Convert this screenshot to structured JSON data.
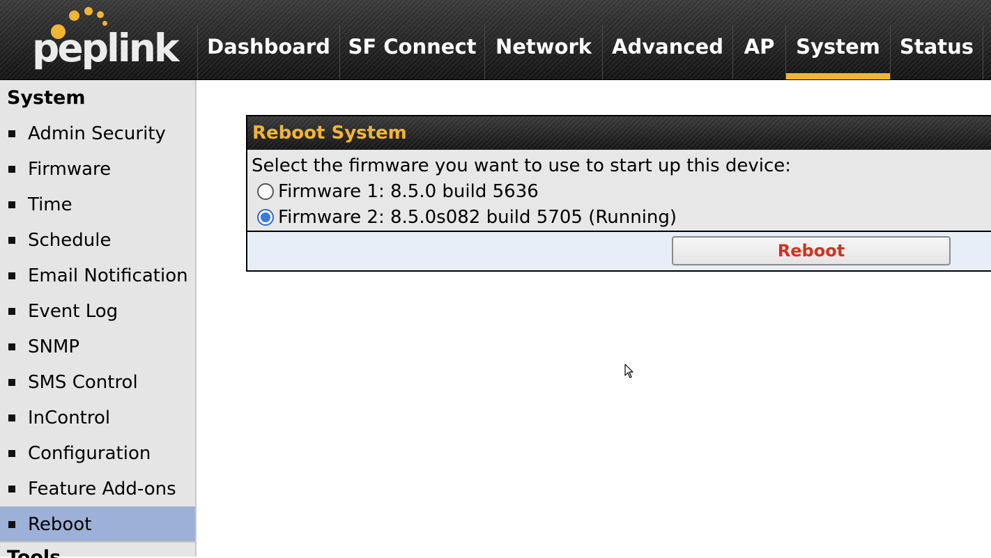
{
  "brand": {
    "logo_text": "peplink",
    "accent": "#f2b533"
  },
  "nav": {
    "items": [
      {
        "label": "Dashboard",
        "active": false
      },
      {
        "label": "SF Connect",
        "active": false
      },
      {
        "label": "Network",
        "active": false
      },
      {
        "label": "Advanced",
        "active": false
      },
      {
        "label": "AP",
        "active": false
      },
      {
        "label": "System",
        "active": true
      },
      {
        "label": "Status",
        "active": false
      }
    ]
  },
  "sidebar": {
    "title": "System",
    "items": [
      {
        "label": "Admin Security"
      },
      {
        "label": "Firmware"
      },
      {
        "label": "Time"
      },
      {
        "label": "Schedule"
      },
      {
        "label": "Email Notification"
      },
      {
        "label": "Event Log"
      },
      {
        "label": "SNMP"
      },
      {
        "label": "SMS Control"
      },
      {
        "label": "InControl"
      },
      {
        "label": "Configuration"
      },
      {
        "label": "Feature Add-ons"
      },
      {
        "label": "Reboot",
        "active": true
      }
    ],
    "next_section": "Tools",
    "active_color": "#9db0d8"
  },
  "panel": {
    "title": "Reboot System",
    "prompt": "Select the firmware you want to use to start up this device:",
    "options": [
      {
        "label": "Firmware 1: 8.5.0 build 5636",
        "checked": false
      },
      {
        "label": "Firmware 2: 8.5.0s082 build 5705 (Running)",
        "checked": true
      }
    ],
    "button_label": "Reboot",
    "button_color": "#d3321e"
  }
}
